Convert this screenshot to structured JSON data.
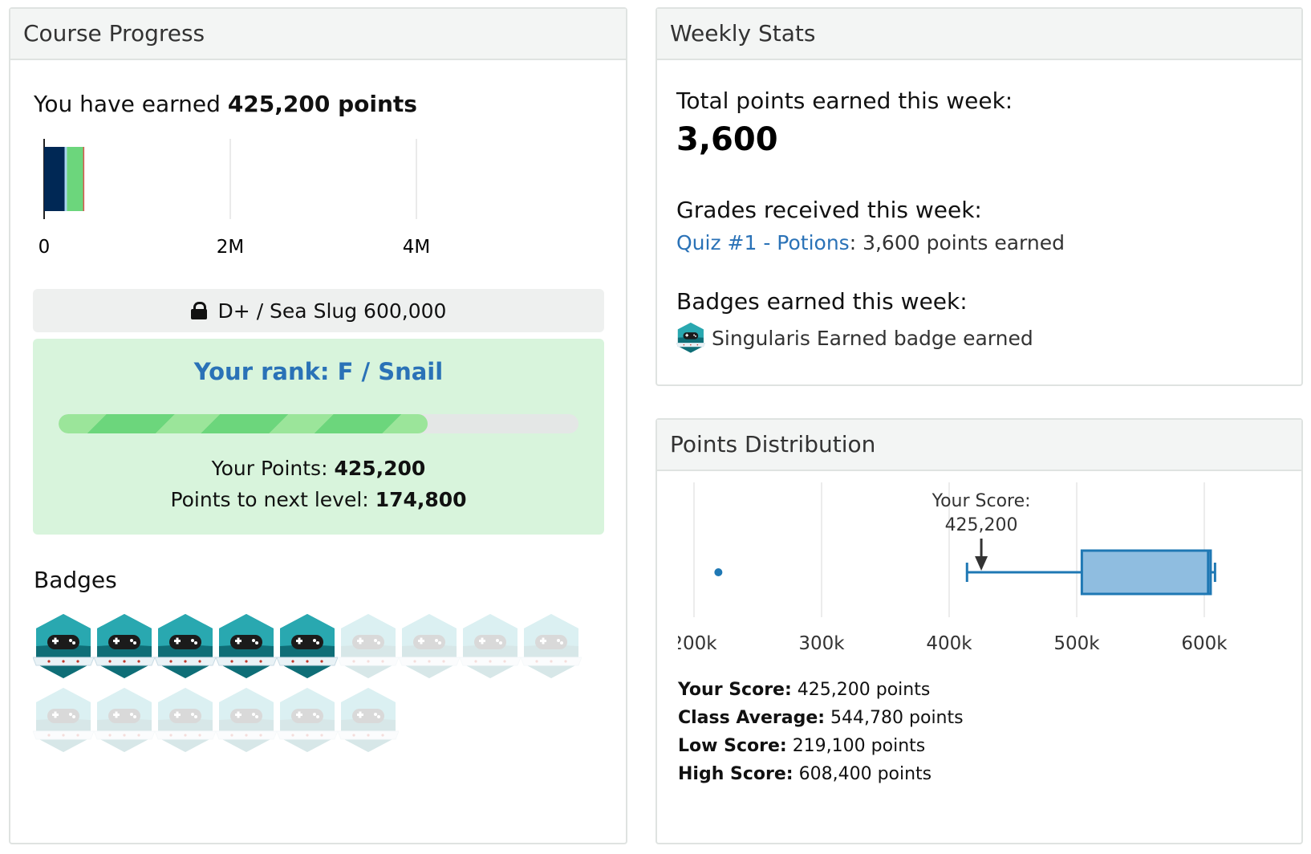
{
  "course": {
    "title": "Course Progress",
    "earned_prefix": "You have earned",
    "earned_points": "425,200 points",
    "axis_ticks": [
      "0",
      "2M",
      "4M"
    ],
    "locked_level": "D+ / Sea Slug 600,000",
    "rank_title": "Your rank: F / Snail",
    "rank_progress_percent": 71,
    "your_points_label": "Your Points:",
    "your_points_value": "425,200",
    "next_level_label": "Points to next level:",
    "next_level_value": "174,800",
    "badges_title": "Badges",
    "badges_earned": 5,
    "badges_total": 15
  },
  "weekly": {
    "title": "Weekly Stats",
    "total_label": "Total points earned this week:",
    "total_value": "3,600",
    "grades_label": "Grades received this week:",
    "grade_link": "Quiz #1 - Potions",
    "grade_suffix": ": 3,600 points earned",
    "badges_label": "Badges earned this week:",
    "badge_text": "Singularis Earned badge earned"
  },
  "distribution": {
    "title": "Points Distribution",
    "annotation_line1": "Your Score:",
    "annotation_line2": "425,200",
    "tick_labels": [
      "200k",
      "300k",
      "400k",
      "500k",
      "600k"
    ],
    "stats": [
      {
        "label": "Your Score:",
        "value": "425,200 points"
      },
      {
        "label": "Class Average:",
        "value": "544,780 points"
      },
      {
        "label": "Low Score:",
        "value": "219,100 points"
      },
      {
        "label": "High Score:",
        "value": "608,400 points"
      }
    ]
  },
  "colors": {
    "navy": "#002855",
    "green": "#6cd67c",
    "link_blue": "#2a72b7",
    "box_fill": "#8fbde0",
    "box_stroke": "#1f78b4",
    "badge_teal": "#1a8a93"
  },
  "chart_data": [
    {
      "type": "bar",
      "orientation": "horizontal",
      "stacked": true,
      "xlim": [
        0,
        5000000
      ],
      "ticks": [
        0,
        2000000,
        4000000
      ],
      "tick_labels": [
        "0",
        "2M",
        "4M"
      ],
      "segments": [
        {
          "color": "#002855",
          "value": 220000
        },
        {
          "color": "#a8d4f0",
          "value": 25000
        },
        {
          "color": "#6cd67c",
          "value": 180200
        }
      ],
      "total": 425200
    },
    {
      "type": "box",
      "xlim": [
        180000,
        620000
      ],
      "ticks": [
        200000,
        300000,
        400000,
        500000,
        600000
      ],
      "tick_labels": [
        "200k",
        "300k",
        "400k",
        "500k",
        "600k"
      ],
      "outliers": [
        219100
      ],
      "whisker_low": 414000,
      "q1": 504000,
      "median": 603000,
      "q3": 605000,
      "whisker_high": 608400,
      "your_score": 425200
    }
  ]
}
